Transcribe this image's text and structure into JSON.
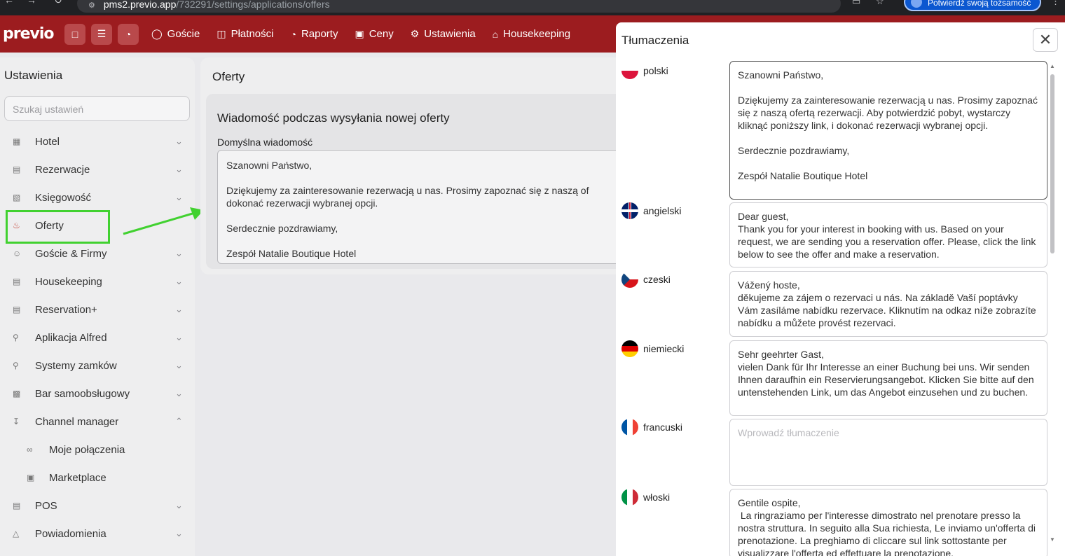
{
  "browser": {
    "url_host": "pms2.previo.app",
    "url_path": "/732291/settings/applications/offers",
    "identity_label": "Potwierdź swoją tożsamość"
  },
  "header": {
    "logo": "previo",
    "nav": [
      {
        "label": "Goście",
        "icon": "user-icon"
      },
      {
        "label": "Płatności",
        "icon": "coins-icon"
      },
      {
        "label": "Raporty",
        "icon": "chart-icon"
      },
      {
        "label": "Ceny",
        "icon": "price-icon"
      },
      {
        "label": "Ustawienia",
        "icon": "gear-icon"
      },
      {
        "label": "Housekeeping",
        "icon": "house-icon"
      }
    ]
  },
  "sidebar": {
    "title": "Ustawienia",
    "search_placeholder": "Szukaj ustawień",
    "items": [
      {
        "label": "Hotel",
        "icon": "building-icon"
      },
      {
        "label": "Rezerwacje",
        "icon": "calendar-icon"
      },
      {
        "label": "Księgowość",
        "icon": "document-icon"
      },
      {
        "label": "Oferty",
        "icon": "offer-icon"
      },
      {
        "label": "Goście & Firmy",
        "icon": "users-icon"
      },
      {
        "label": "Housekeeping",
        "icon": "housekeeping-icon"
      },
      {
        "label": "Reservation+",
        "icon": "calendar-plus-icon"
      },
      {
        "label": "Aplikacja Alfred",
        "icon": "person-icon"
      },
      {
        "label": "Systemy zamków",
        "icon": "key-icon"
      },
      {
        "label": "Bar samoobsługowy",
        "icon": "qr-icon"
      },
      {
        "label": "Channel manager",
        "icon": "download-icon"
      },
      {
        "label": "Moje połączenia",
        "icon": "link-icon"
      },
      {
        "label": "Marketplace",
        "icon": "cart-icon"
      },
      {
        "label": "POS",
        "icon": "register-icon"
      },
      {
        "label": "Powiadomienia",
        "icon": "bell-icon"
      }
    ]
  },
  "main": {
    "title": "Oferty",
    "card_title": "Wiadomość podczas wysyłania nowej oferty",
    "default_label": "Domyślna wiadomość",
    "default_message": "Szanowni Państwo,\n\nDziękujemy za zainteresowanie rezerwacją u nas. Prosimy zapoznać się z naszą of\ndokonać rezerwacji wybranej opcji.\n\nSerdecznie pozdrawiamy,\n\nZespół Natalie Boutique Hotel"
  },
  "dialog": {
    "title": "Tłumaczenia",
    "translation_placeholder": "Wprowadź tłumaczenie",
    "languages": [
      {
        "name": "polski",
        "text": "Szanowni Państwo,\n\nDziękujemy za zainteresowanie rezerwacją u nas. Prosimy zapoznać się z naszą ofertą rezerwacji. Aby potwierdzić pobyt, wystarczy kliknąć poniższy link, i dokonać rezerwacji wybranej opcji.\n\nSerdecznie pozdrawiamy,\n\nZespół Natalie Boutique Hotel"
      },
      {
        "name": "angielski",
        "text": "Dear guest,\nThank you for your interest in booking with us. Based on your request, we are sending you a reservation offer. Please, click the link below to see the offer and make a reservation."
      },
      {
        "name": "czeski",
        "text": "Vážený hoste,\nděkujeme za zájem o rezervaci u nás. Na základě Vaší poptávky Vám zasíláme nabídku rezervace. Kliknutím na odkaz níže zobrazíte nabídku a můžete provést rezervaci."
      },
      {
        "name": "niemiecki",
        "text": "Sehr geehrter Gast,\nvielen Dank für Ihr Interesse an einer Buchung bei uns. Wir senden Ihnen daraufhin ein Reservierungsangebot. Klicken Sie bitte auf den untenstehenden Link, um das Angebot einzusehen und zu buchen."
      },
      {
        "name": "francuski",
        "text": ""
      },
      {
        "name": "włoski",
        "text": "Gentile ospite,\n La ringraziamo per l'interesse dimostrato nel prenotare presso la nostra struttura. In seguito alla Sua richiesta, Le inviamo un'offerta di prenotazione. La preghiamo di cliccare sul link sottostante per visualizzare l'offerta ed effettuare la prenotazione."
      }
    ]
  }
}
